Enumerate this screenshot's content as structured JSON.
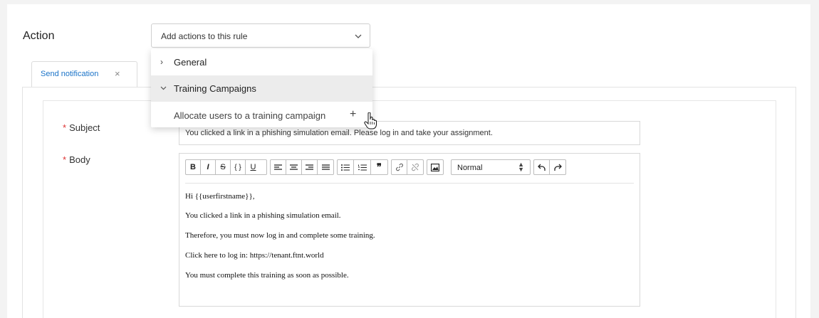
{
  "action": {
    "title": "Action",
    "select_placeholder": "Add actions to this rule"
  },
  "dropdown": {
    "groups": [
      {
        "label": "General",
        "expanded": false
      },
      {
        "label": "Training Campaigns",
        "expanded": true
      }
    ],
    "sub_item": "Allocate users to a training campaign",
    "add_symbol": "+"
  },
  "tab": {
    "label": "Send notification",
    "close": "×"
  },
  "form": {
    "subject": {
      "required_marker": "*",
      "label": "Subject",
      "value": "You clicked a link in a phishing simulation email. Please log in and take your assignment."
    },
    "body": {
      "required_marker": "*",
      "label": "Body",
      "format_value": "Normal",
      "lines": [
        "Hi {{userfirstname}},",
        "You clicked a link in a phishing simulation email.",
        "Therefore, you must now log in and complete some training.",
        "Click here to log in: https://tenant.ftnt.world",
        "You must complete this training as soon as possible."
      ]
    }
  },
  "toolbar": {
    "bold": "B",
    "italic": "I",
    "strike": "S",
    "code": "{ }",
    "underline": "U"
  },
  "colors": {
    "accent": "#1a73c8",
    "required": "#d33333",
    "hover_row": "#ececec"
  }
}
